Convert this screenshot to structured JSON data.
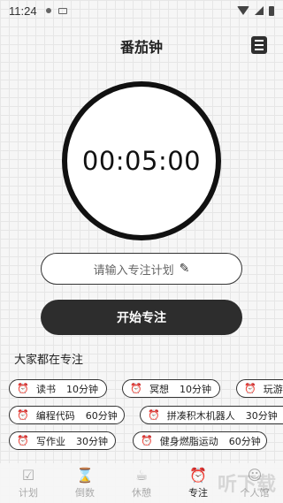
{
  "status": {
    "time": "11:24"
  },
  "header": {
    "title": "番茄钟"
  },
  "timer": {
    "display": "00:05:00"
  },
  "plan_input": {
    "placeholder": "请输入专注计划"
  },
  "start_button": {
    "label": "开始专注"
  },
  "section": {
    "title": "大家都在专注"
  },
  "chips": [
    {
      "name": "读书",
      "duration": "10分钟"
    },
    {
      "name": "冥想",
      "duration": "10分钟"
    },
    {
      "name": "玩游戏",
      "duration": ""
    },
    {
      "name": "编程代码",
      "duration": "60分钟"
    },
    {
      "name": "拼凑积木机器人",
      "duration": "30分钟"
    },
    {
      "name": "写作业",
      "duration": "30分钟"
    },
    {
      "name": "健身燃脂运动",
      "duration": "60分钟"
    }
  ],
  "tabs": [
    {
      "label": "计划",
      "icon": "checklist-icon"
    },
    {
      "label": "倒数",
      "icon": "hourglass-icon"
    },
    {
      "label": "休憩",
      "icon": "coffee-icon"
    },
    {
      "label": "专注",
      "icon": "alarm-clock-icon"
    },
    {
      "label": "个人馆",
      "icon": "person-icon"
    }
  ],
  "watermark": "听下载"
}
